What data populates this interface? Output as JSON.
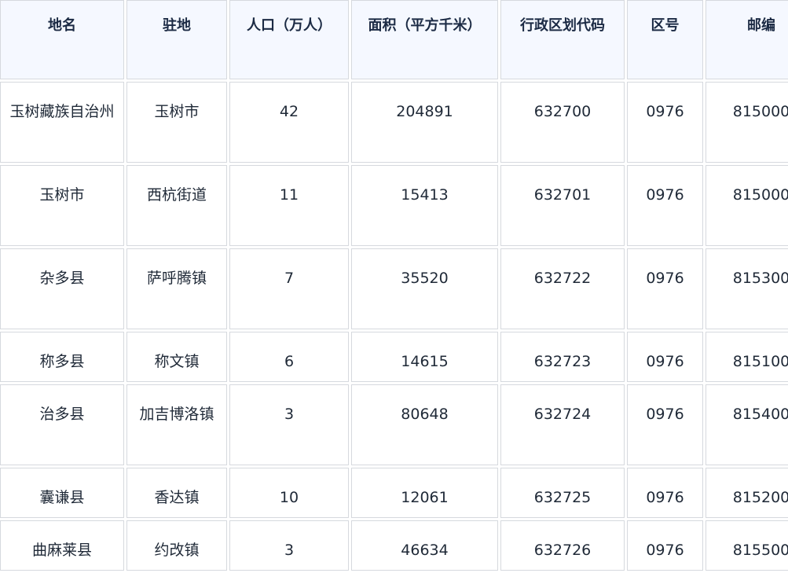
{
  "headers": {
    "name": "地名",
    "seat": "驻地",
    "population": "人口（万人）",
    "area": "面积（平方千米）",
    "code": "行政区划代码",
    "zone": "区号",
    "postcode": "邮编"
  },
  "rows": [
    {
      "name": "玉树藏族自治州",
      "seat": "玉树市",
      "population": "42",
      "area": "204891",
      "code": "632700",
      "zone": "0976",
      "postcode": "815000"
    },
    {
      "name": "玉树市",
      "seat": "西杭街道",
      "population": "11",
      "area": "15413",
      "code": "632701",
      "zone": "0976",
      "postcode": "815000"
    },
    {
      "name": "杂多县",
      "seat": "萨呼腾镇",
      "population": "7",
      "area": "35520",
      "code": "632722",
      "zone": "0976",
      "postcode": "815300"
    },
    {
      "name": "称多县",
      "seat": "称文镇",
      "population": "6",
      "area": "14615",
      "code": "632723",
      "zone": "0976",
      "postcode": "815100"
    },
    {
      "name": "治多县",
      "seat": "加吉博洛镇",
      "population": "3",
      "area": "80648",
      "code": "632724",
      "zone": "0976",
      "postcode": "815400"
    },
    {
      "name": "囊谦县",
      "seat": "香达镇",
      "population": "10",
      "area": "12061",
      "code": "632725",
      "zone": "0976",
      "postcode": "815200"
    },
    {
      "name": "曲麻莱县",
      "seat": "约改镇",
      "population": "3",
      "area": "46634",
      "code": "632726",
      "zone": "0976",
      "postcode": "815500"
    }
  ]
}
